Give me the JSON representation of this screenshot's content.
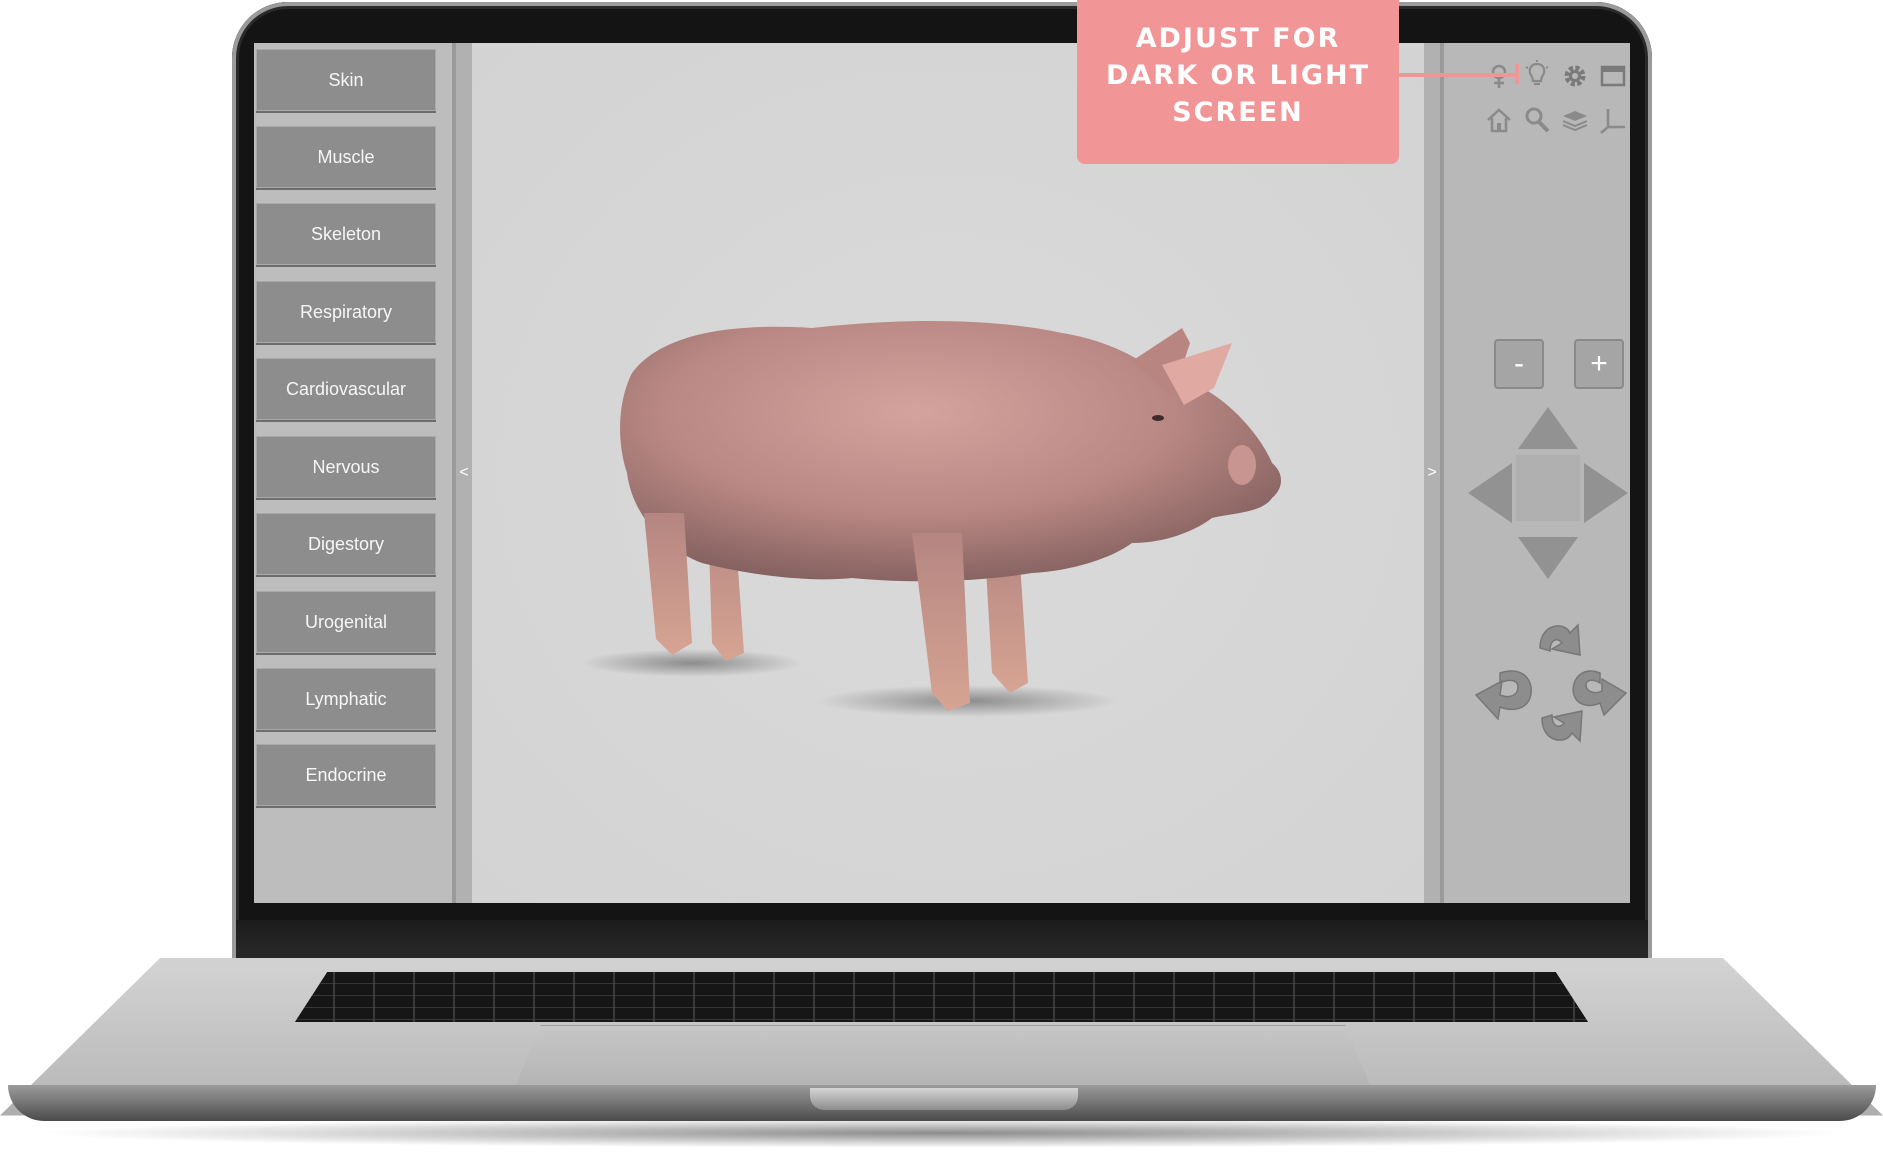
{
  "callout": {
    "lines": [
      "ADJUST FOR",
      "DARK OR LIGHT",
      "SCREEN"
    ],
    "color": "#f29597"
  },
  "sidebar": {
    "items": [
      {
        "label": "Skin"
      },
      {
        "label": "Muscle"
      },
      {
        "label": "Skeleton"
      },
      {
        "label": "Respiratory"
      },
      {
        "label": "Cardiovascular"
      },
      {
        "label": "Nervous"
      },
      {
        "label": "Digestory"
      },
      {
        "label": "Urogenital"
      },
      {
        "label": "Lymphatic"
      },
      {
        "label": "Endocrine"
      }
    ],
    "collapse_glyph": "<"
  },
  "right_panel": {
    "expand_glyph": ">",
    "top_icons": [
      "pin-icon",
      "lightbulb-icon",
      "gear-icon",
      "window-icon"
    ],
    "second_row_icons": [
      "home-icon",
      "search-icon",
      "layers-icon",
      "axes-icon"
    ],
    "zoom_out_label": "-",
    "zoom_in_label": "+",
    "pan_arrows": [
      "arrow-up-icon",
      "arrow-left-icon",
      "arrow-right-icon",
      "arrow-down-icon"
    ],
    "rotate_arrows": [
      "rotate-up-icon",
      "rotate-left-icon",
      "rotate-right-icon",
      "rotate-down-icon"
    ]
  },
  "viewport": {
    "model": "pig-3d-model"
  },
  "colors": {
    "button_bg": "#8d8d8d",
    "sidebar_bg": "#bdbdbd",
    "viewport_bg": "#d6d6d6",
    "pig_skin": "#c9958f"
  }
}
